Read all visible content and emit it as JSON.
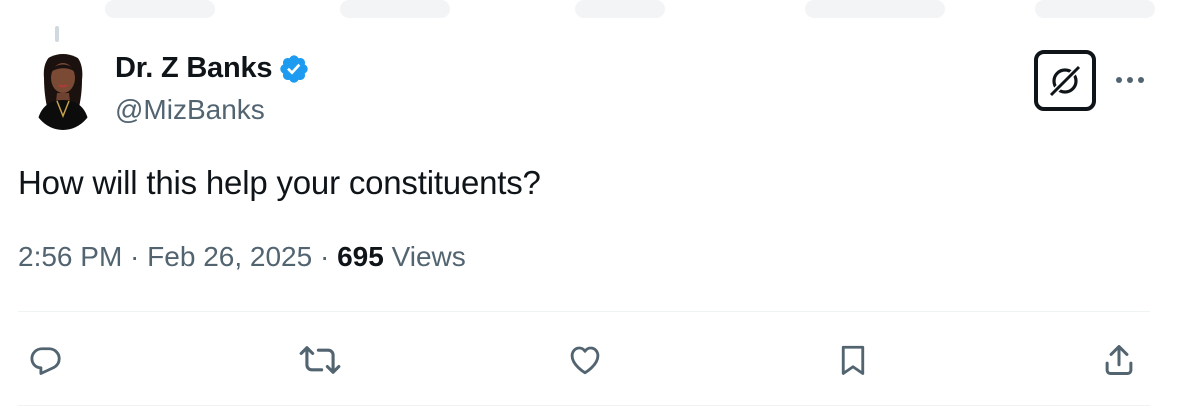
{
  "tweet": {
    "author": {
      "display_name": "Dr. Z Banks",
      "handle": "@MizBanks",
      "verified": true,
      "verified_color": "#1d9bf0"
    },
    "text": "How will this help your constituents?",
    "time": "2:56 PM",
    "separator": " · ",
    "date": "Feb 26, 2025",
    "views_count": "695",
    "views_label": " Views"
  },
  "icons": {
    "grok": "grok-icon",
    "more": "more-icon",
    "reply": "reply-icon",
    "retweet": "retweet-icon",
    "like": "like-icon",
    "bookmark": "bookmark-icon",
    "share": "share-icon"
  },
  "colors": {
    "text_primary": "#0f1419",
    "text_secondary": "#536471",
    "divider": "#eff3f4"
  }
}
